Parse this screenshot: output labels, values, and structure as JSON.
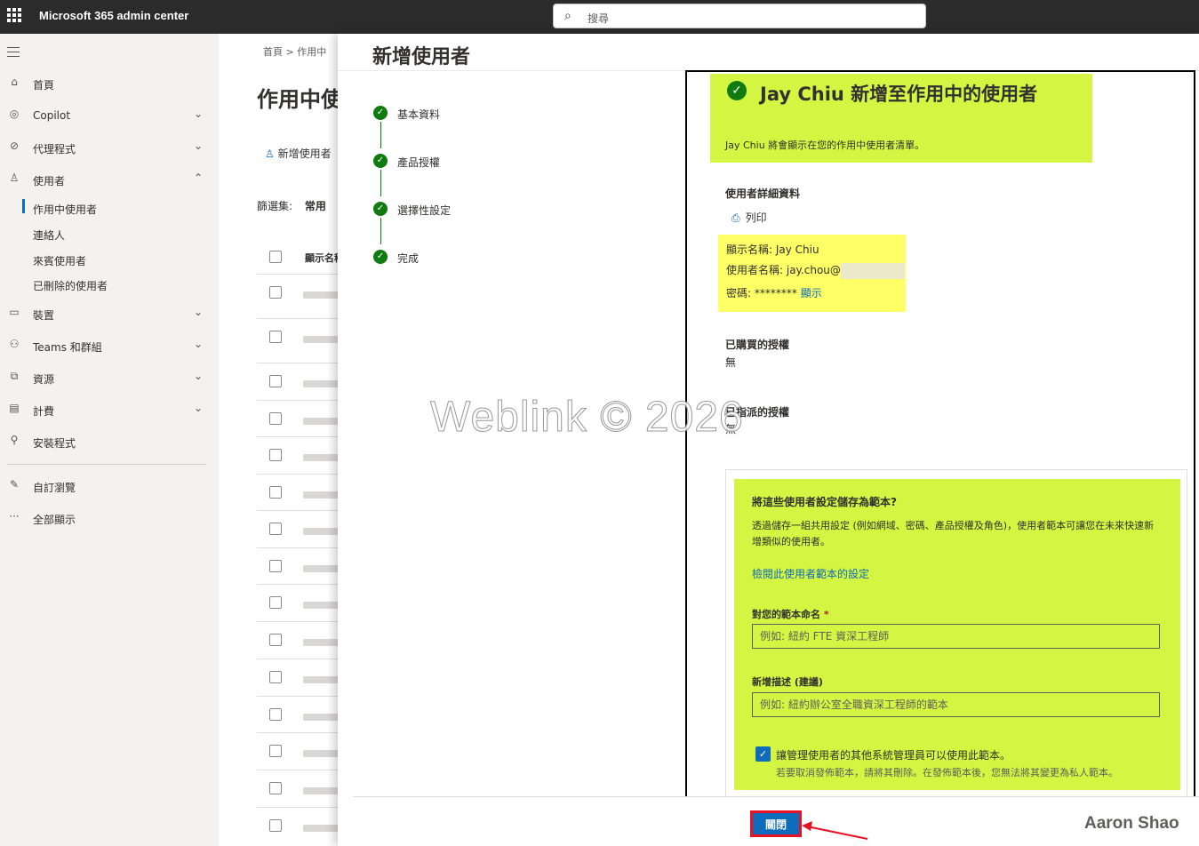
{
  "topbar": {
    "app_title": "Microsoft 365 admin center",
    "search_placeholder": "搜尋"
  },
  "nav": {
    "items": [
      {
        "label": "首頁",
        "icon": "home-icon"
      },
      {
        "label": "Copilot",
        "icon": "copilot-icon"
      },
      {
        "label": "代理程式",
        "icon": "agent-icon"
      },
      {
        "label": "使用者",
        "icon": "user-icon"
      },
      {
        "label": "裝置",
        "icon": "device-icon"
      },
      {
        "label": "Teams 和群組",
        "icon": "teams-icon"
      },
      {
        "label": "資源",
        "icon": "resource-icon"
      },
      {
        "label": "計費",
        "icon": "billing-icon"
      },
      {
        "label": "安裝程式",
        "icon": "setup-icon"
      },
      {
        "label": "自訂瀏覽",
        "icon": "customize-icon"
      },
      {
        "label": "全部顯示",
        "icon": "more-icon"
      }
    ],
    "user_sub": [
      "作用中使用者",
      "連絡人",
      "來賓使用者",
      "已刪除的使用者"
    ]
  },
  "background_page": {
    "breadcrumb": "首頁 > 作用中",
    "title": "作用中使",
    "add_user": "新增使用者",
    "filter_label": "篩選集:",
    "filter_value": "常用",
    "column_header": "顯示名稱"
  },
  "panel": {
    "title": "新增使用者",
    "steps": [
      "基本資料",
      "產品授權",
      "選擇性設定",
      "完成"
    ],
    "watermark": "Weblink © 2026",
    "success_title": "Jay Chiu 新增至作用中的使用者",
    "success_sub": "Jay Chiu 將會顯示在您的作用中使用者清單。",
    "details_heading": "使用者詳細資料",
    "print_label": "列印",
    "display_name": "顯示名稱: Jay Chiu",
    "username": "使用者名稱: jay.chou@",
    "password_label": "密碼: ******** ",
    "show_link": "顯示",
    "purchased_heading": "已購買的授權",
    "purchased_value": "無",
    "assigned_heading": "已指派的授權",
    "assigned_value": "無",
    "template": {
      "title": "將這些使用者設定儲存為範本?",
      "desc": "透過儲存一組共用設定 (例如網域、密碼、產品授權及角色)，使用者範本可讓您在未來快速新增類似的使用者。",
      "review_link": "檢閱此使用者範本的設定",
      "name_label": "對您的範本命名",
      "name_placeholder": "例如: 紐約 FTE 資深工程師",
      "desc_label": "新增描述 (建議)",
      "desc_placeholder": "例如: 紐約辦公室全職資深工程師的範本",
      "share_label": "讓管理使用者的其他系統管理員可以使用此範本。",
      "share_note": "若要取消發佈範本，請將其刪除。在發佈範本後，您無法將其變更為私人範本。"
    },
    "close_button": "關閉"
  },
  "signature": "Aaron Shao",
  "colors": {
    "accent": "#0f6cbd",
    "success": "#107c10",
    "highlight_green": "#d4f542",
    "highlight_yellow": "#ffff66",
    "annotation_red": "#e81123"
  }
}
